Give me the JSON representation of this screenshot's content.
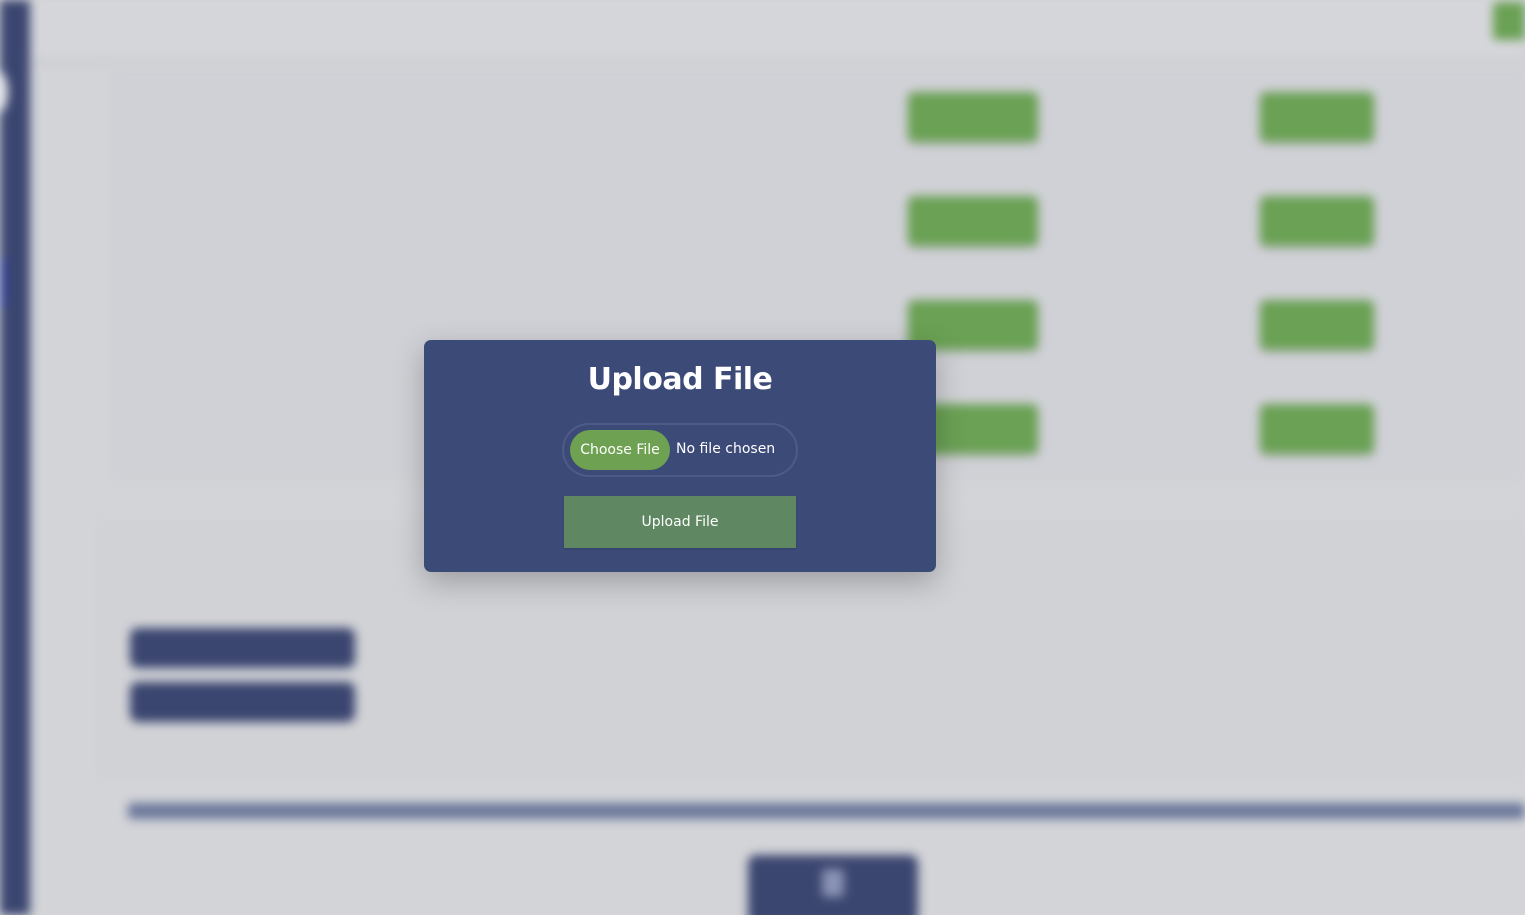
{
  "modal": {
    "title": "Upload File",
    "choose_file_label": "Choose File",
    "file_status": "No file chosen",
    "upload_button_label": "Upload File"
  },
  "background": {
    "blurred": true,
    "accent_green": "#6aa154",
    "navy": "#3b4670"
  },
  "colors": {
    "modal_bg": "#3c4a78",
    "choose_btn": "#6ea152",
    "upload_btn": "#5f8862",
    "overlay_bg": "#d3d4d8"
  }
}
